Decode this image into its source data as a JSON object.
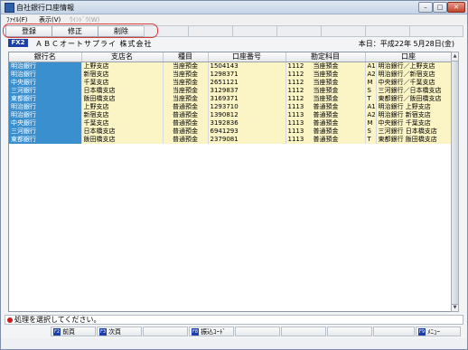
{
  "window": {
    "title": "自社銀行口座情報",
    "min": "–",
    "max": "□",
    "close": "✕"
  },
  "menu": [
    {
      "label": "ﾌｧｲﾙ(F)",
      "disabled": false
    },
    {
      "label": "表示(V)",
      "disabled": false
    },
    {
      "label": "ｳｲﾝﾄﾞｳ(W)",
      "disabled": true
    }
  ],
  "toolbar": {
    "register": "登録",
    "edit": "修正",
    "delete": "削除"
  },
  "info": {
    "code": "FX2",
    "company": "ＡＢＣオートサプライ 株式会社",
    "date": "本日：平成22年 5月28日(金)"
  },
  "table": {
    "headers": [
      "銀行名",
      "支店名",
      "種目",
      "口座番号",
      "勘定科目",
      "口座"
    ],
    "rows": [
      {
        "bank": "明治銀行",
        "branch": "上野支店",
        "type": "当座預金",
        "number": "1504143",
        "acct_code": "1112",
        "acct_name": "当座預金",
        "key": "A1",
        "label": "明治銀行／上野支店"
      },
      {
        "bank": "明治銀行",
        "branch": "新宿支店",
        "type": "当座預金",
        "number": "1298371",
        "acct_code": "1112",
        "acct_name": "当座預金",
        "key": "A2",
        "label": "明治銀行／新宿支店"
      },
      {
        "bank": "中央銀行",
        "branch": "千葉支店",
        "type": "当座預金",
        "number": "2651121",
        "acct_code": "1112",
        "acct_name": "当座預金",
        "key": "M",
        "label": "中央銀行／千葉支店"
      },
      {
        "bank": "三河銀行",
        "branch": "日本橋支店",
        "type": "当座預金",
        "number": "3129837",
        "acct_code": "1112",
        "acct_name": "当座預金",
        "key": "S",
        "label": "三河銀行／日本橋支店"
      },
      {
        "bank": "東都銀行",
        "branch": "飯田橋支店",
        "type": "当座預金",
        "number": "3169371",
        "acct_code": "1112",
        "acct_name": "当座預金",
        "key": "T",
        "label": "東都銀行／飯田橋支店"
      },
      {
        "bank": "明治銀行",
        "branch": "上野支店",
        "type": "普通預金",
        "number": "1293710",
        "acct_code": "1113",
        "acct_name": "普通預金",
        "key": "A1",
        "label": "明治銀行 上野支店"
      },
      {
        "bank": "明治銀行",
        "branch": "新宿支店",
        "type": "普通預金",
        "number": "1390812",
        "acct_code": "1113",
        "acct_name": "普通預金",
        "key": "A2",
        "label": "明治銀行 新宿支店"
      },
      {
        "bank": "中央銀行",
        "branch": "千葉支店",
        "type": "普通預金",
        "number": "3192836",
        "acct_code": "1113",
        "acct_name": "普通預金",
        "key": "M",
        "label": "中央銀行 千葉支店"
      },
      {
        "bank": "三河銀行",
        "branch": "日本橋支店",
        "type": "普通預金",
        "number": "6941293",
        "acct_code": "1113",
        "acct_name": "普通預金",
        "key": "S",
        "label": "三河銀行 日本橋支店"
      },
      {
        "bank": "東都銀行",
        "branch": "飯田橋支店",
        "type": "普通預金",
        "number": "2379081",
        "acct_code": "1113",
        "acct_name": "普通預金",
        "key": "T",
        "label": "東都銀行 飯田橋支店"
      }
    ]
  },
  "status": {
    "message": "処理を選択してください。"
  },
  "fkeys": {
    "f2": {
      "key": "F2",
      "label": "前頁"
    },
    "f3": {
      "key": "F3",
      "label": "次頁"
    },
    "f8": {
      "key": "F8",
      "label": "振込ｺｰﾄﾞ"
    },
    "f9": {
      "key": "F9",
      "label": "ﾒﾆｭｰ"
    }
  },
  "colors": {
    "selected_row": "#fbf5c5",
    "selected_first_cell": "#3a8fcf",
    "code_badge": "#1d3fa8",
    "highlight_ring": "#d83a3a"
  }
}
